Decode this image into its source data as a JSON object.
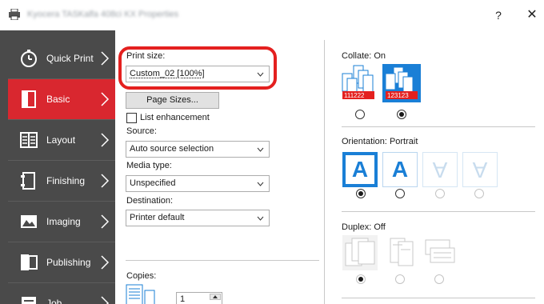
{
  "window": {
    "title": "Kyocera TASKalfa 408ci KX Properties",
    "help_label": "?",
    "close_label": "✕"
  },
  "sidebar": {
    "items": [
      {
        "label": "Quick Print",
        "icon": "stopwatch-icon",
        "active": false
      },
      {
        "label": "Basic",
        "icon": "page-icon",
        "active": true
      },
      {
        "label": "Layout",
        "icon": "layout-icon",
        "active": false
      },
      {
        "label": "Finishing",
        "icon": "finishing-icon",
        "active": false
      },
      {
        "label": "Imaging",
        "icon": "image-icon",
        "active": false
      },
      {
        "label": "Publishing",
        "icon": "publishing-icon",
        "active": false
      },
      {
        "label": "Job",
        "icon": "job-icon",
        "active": false
      }
    ],
    "active_color": "#d9272f",
    "background_color": "#4a4a4a"
  },
  "basic": {
    "print_size_label": "Print size:",
    "print_size_value": "Custom_02 [100%]",
    "page_sizes_button": "Page Sizes...",
    "list_enhancement_label": "List enhancement",
    "list_enhancement_checked": false,
    "source_label": "Source:",
    "source_value": "Auto source selection",
    "media_type_label": "Media type:",
    "media_type_value": "Unspecified",
    "destination_label": "Destination:",
    "destination_value": "Printer default",
    "copies_label": "Copies:",
    "copies_value": "1"
  },
  "collate": {
    "label": "Collate:",
    "state": "On",
    "options": [
      {
        "name": "uncollated",
        "digits": "111222",
        "selected": false
      },
      {
        "name": "collated",
        "digits": "123123",
        "selected": true
      }
    ]
  },
  "orientation": {
    "label": "Orientation:",
    "state": "Portrait",
    "options": [
      {
        "name": "portrait",
        "glyph": "A",
        "selected": true,
        "enabled": true
      },
      {
        "name": "landscape",
        "glyph": "A",
        "selected": false,
        "enabled": true
      },
      {
        "name": "rotated-portrait",
        "glyph": "A",
        "selected": false,
        "enabled": false
      },
      {
        "name": "rotated-landscape",
        "glyph": "A",
        "selected": false,
        "enabled": false
      }
    ]
  },
  "duplex": {
    "label": "Duplex:",
    "state": "Off",
    "options": [
      {
        "name": "off",
        "selected": true,
        "enabled": false
      },
      {
        "name": "long-edge",
        "selected": false,
        "enabled": false
      },
      {
        "name": "short-edge",
        "selected": false,
        "enabled": false
      }
    ]
  },
  "colors": {
    "accent_blue": "#1a7fd6",
    "highlight_red": "#e4201f"
  }
}
